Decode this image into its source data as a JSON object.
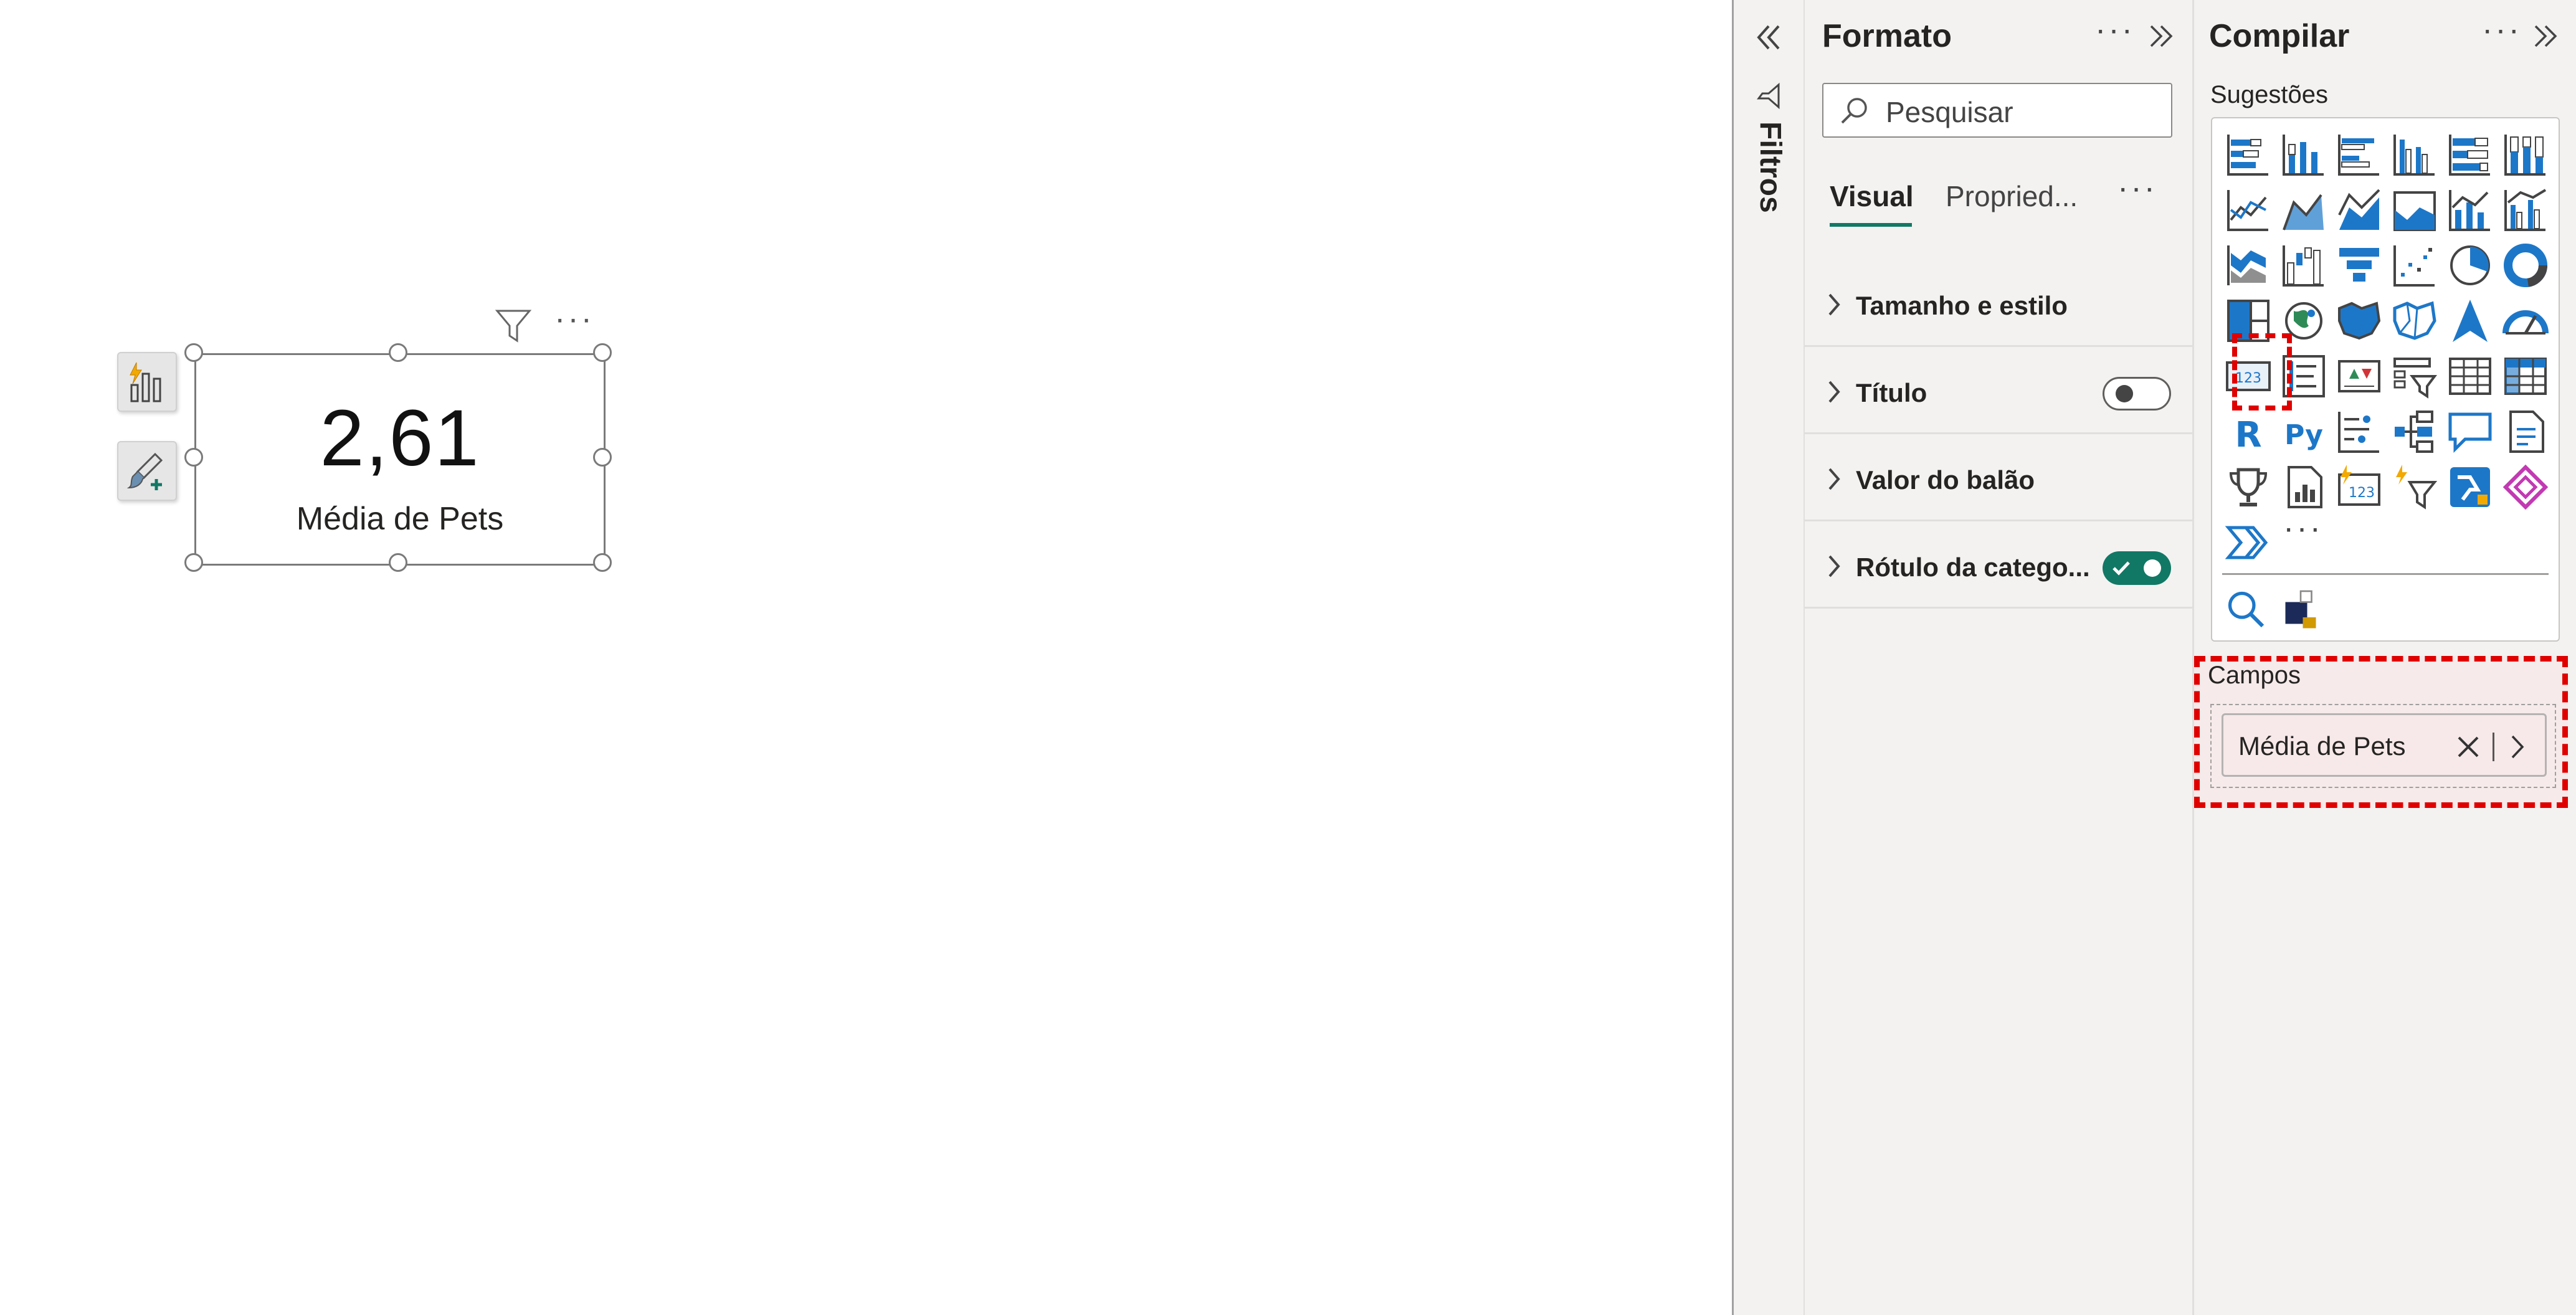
{
  "canvas": {
    "card": {
      "value": "2,61",
      "label": "Média de Pets"
    }
  },
  "filters_pane": {
    "label": "Filtros"
  },
  "format_pane": {
    "title": "Formato",
    "more": "···",
    "search": {
      "placeholder": "Pesquisar"
    },
    "tabs": [
      {
        "label": "Visual"
      },
      {
        "label": "Propried..."
      }
    ],
    "sections": [
      {
        "label": "Tamanho e estilo"
      },
      {
        "label": "Título",
        "toggle": "off"
      },
      {
        "label": "Valor do balão"
      },
      {
        "label": "Rótulo da catego...",
        "toggle": "on"
      }
    ]
  },
  "build_pane": {
    "title": "Compilar",
    "more": "···",
    "suggestions_label": "Sugestões",
    "more_visuals": "···",
    "fields_label": "Campos",
    "field_pill": "Média de Pets"
  },
  "colors": {
    "accent": "#117865",
    "highlight": "#e00000",
    "pane_bg": "#f3f2f1",
    "icon_blue": "#1d77c8"
  }
}
